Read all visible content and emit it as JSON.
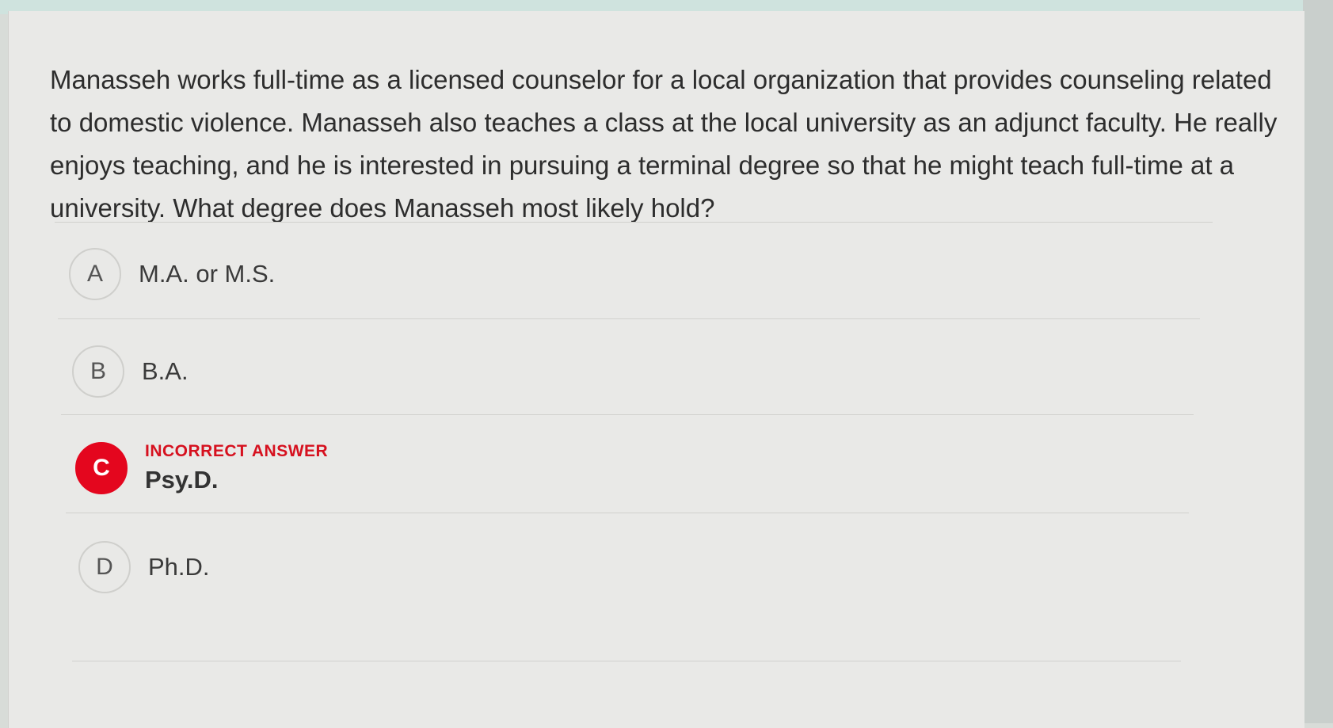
{
  "question": {
    "text": "Manasseh works full-time as a licensed counselor for a local organization that provides counseling related to domestic violence. Manasseh also teaches a class at the local university as an adjunct faculty. He really enjoys teaching, and he is interested in pursuing a terminal degree so that he might teach full-time at a university. What degree does Manasseh most likely hold?"
  },
  "options": [
    {
      "letter": "A",
      "text": "M.A. or M.S."
    },
    {
      "letter": "B",
      "text": "B.A."
    },
    {
      "letter": "C",
      "text": "Psy.D.",
      "status": "INCORRECT ANSWER"
    },
    {
      "letter": "D",
      "text": "Ph.D."
    }
  ],
  "colors": {
    "incorrect": "#e4061e",
    "card_background": "#e9e9e7",
    "top_strip": "#cfe3de"
  }
}
